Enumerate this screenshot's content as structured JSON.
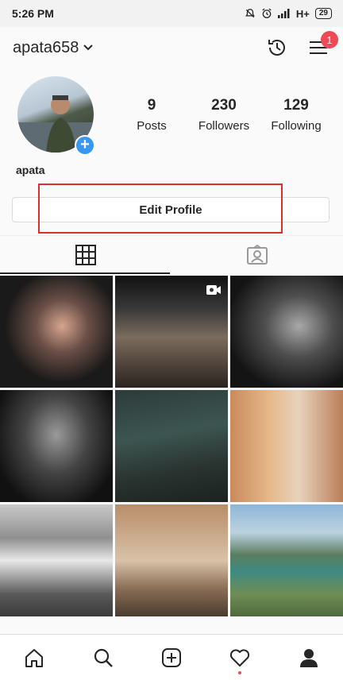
{
  "status_bar": {
    "time": "5:26 PM",
    "network": "H+",
    "battery": "29"
  },
  "header": {
    "username": "apata658",
    "notification_count": "1"
  },
  "profile": {
    "display_name": "apata",
    "stats": [
      {
        "value": "9",
        "label": "Posts"
      },
      {
        "value": "230",
        "label": "Followers"
      },
      {
        "value": "129",
        "label": "Following"
      }
    ],
    "edit_button": "Edit Profile"
  },
  "tabs": [
    {
      "icon": "grid-icon",
      "active": true
    },
    {
      "icon": "tagged-icon",
      "active": false
    }
  ],
  "posts": [
    {
      "id": "post-1",
      "subject": "workout-couple"
    },
    {
      "id": "post-2",
      "subject": "bench-press",
      "type": "video"
    },
    {
      "id": "post-3",
      "subject": "dumbbell-curl"
    },
    {
      "id": "post-4",
      "subject": "bodybuilder"
    },
    {
      "id": "post-5",
      "subject": "deadlift"
    },
    {
      "id": "post-6",
      "subject": "dog-camera"
    },
    {
      "id": "post-7",
      "subject": "cars"
    },
    {
      "id": "post-8",
      "subject": "fog-hill"
    },
    {
      "id": "post-9",
      "subject": "lake-mountains"
    }
  ],
  "bottom_nav": [
    "home-icon",
    "search-icon",
    "add-post-icon",
    "activity-icon",
    "profile-icon"
  ],
  "colors": {
    "accent_blue": "#3897f0",
    "badge_red": "#ed4956",
    "highlight_red": "#d9302c"
  }
}
